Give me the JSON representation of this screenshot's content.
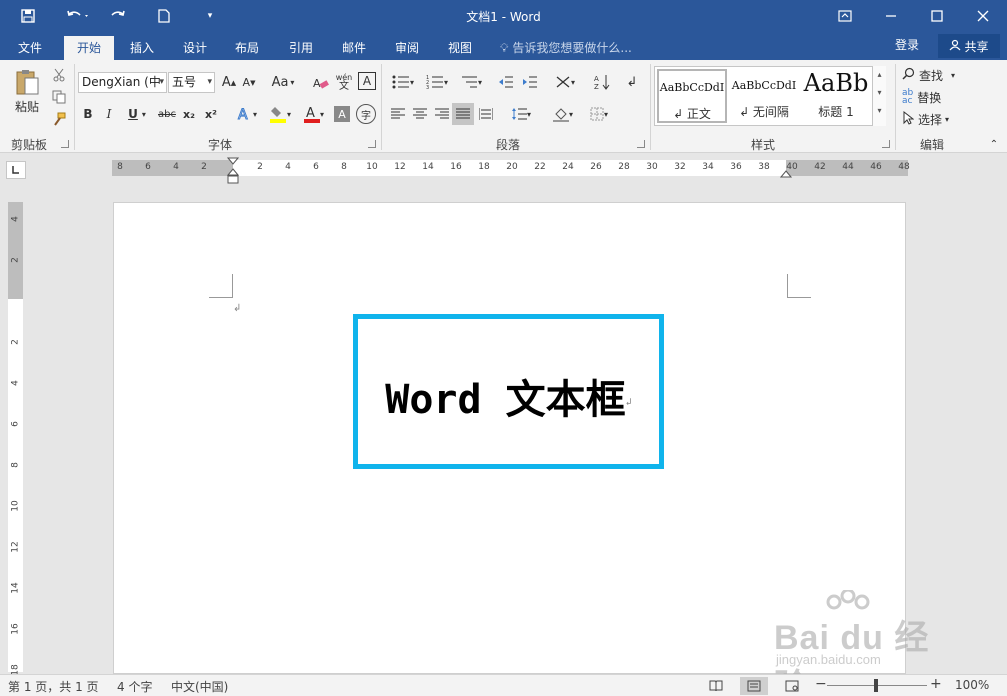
{
  "window": {
    "title": "文档1 - Word"
  },
  "tabs": [
    {
      "label": "文件"
    },
    {
      "label": "开始"
    },
    {
      "label": "插入"
    },
    {
      "label": "设计"
    },
    {
      "label": "布局"
    },
    {
      "label": "引用"
    },
    {
      "label": "邮件"
    },
    {
      "label": "审阅"
    },
    {
      "label": "视图"
    }
  ],
  "tell_me": "告诉我您想要做什么...",
  "account": {
    "login": "登录",
    "share": "共享"
  },
  "ribbon": {
    "clipboard": {
      "label": "剪贴板",
      "paste": "粘贴"
    },
    "font": {
      "label": "字体",
      "font_name": "DengXian (中",
      "font_size": "五号",
      "grow": "A",
      "shrink": "A",
      "change_case": "Aa",
      "bold": "B",
      "italic": "I",
      "underline": "U",
      "strike": "abc",
      "subscript": "x₂",
      "superscript": "x²",
      "phonetic": "wén",
      "char_border": "A",
      "char_shading": "A",
      "enclose": "字"
    },
    "paragraph": {
      "label": "段落"
    },
    "styles": {
      "label": "样式",
      "items": [
        {
          "sample": "AaBbCcDdI",
          "name": "↲ 正文"
        },
        {
          "sample": "AaBbCcDdI",
          "name": "↲ 无间隔"
        },
        {
          "sample": "AaBb",
          "name": "标题 1"
        }
      ]
    },
    "editing": {
      "label": "编辑",
      "find": "查找",
      "replace": "替换",
      "select": "选择"
    }
  },
  "ruler": {
    "horizontal_labels": [
      "8",
      "6",
      "4",
      "2",
      "",
      "2",
      "4",
      "6",
      "8",
      "10",
      "12",
      "14",
      "16",
      "18",
      "20",
      "22",
      "24",
      "26",
      "28",
      "30",
      "32",
      "34",
      "36",
      "38",
      "40",
      "42",
      "44",
      "46",
      "48"
    ],
    "vertical_labels": [
      "4",
      "2",
      "",
      "2",
      "4",
      "6",
      "8",
      "10",
      "12",
      "14",
      "16",
      "18"
    ]
  },
  "document": {
    "textbox_text": "Word 文本框"
  },
  "status": {
    "page": "第 1 页，共 1 页",
    "words": "4 个字",
    "language": "中文(中国)",
    "zoom": "100%"
  },
  "watermark": {
    "brand": "Bai du 经验",
    "url": "jingyan.baidu.com"
  },
  "colors": {
    "title_bar": "#2b579a",
    "textbox_border": "#10b4ec"
  }
}
